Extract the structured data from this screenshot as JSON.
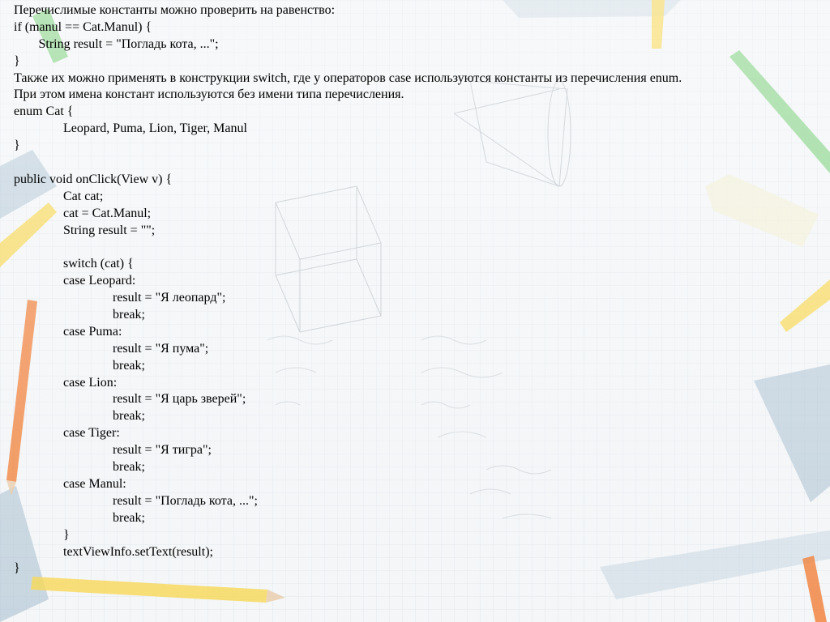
{
  "lines": [
    {
      "indent": 0,
      "text": "Перечислимые константы можно проверить на равенство:"
    },
    {
      "indent": 0,
      "text": "if (manul == Cat.Manul) {"
    },
    {
      "indent": 0.5,
      "text": "String result = \"Погладь кота, ...\";"
    },
    {
      "indent": 0,
      "text": "}"
    },
    {
      "indent": 0,
      "text": "Также их можно применять в конструкции switch, где у операторов case используются константы из перечисления enum."
    },
    {
      "indent": 0,
      "text": "При этом имена констант используются без имени типа перечисления."
    },
    {
      "indent": 0,
      "text": "enum Cat {"
    },
    {
      "indent": 1,
      "text": "Leopard, Puma, Lion, Tiger, Manul"
    },
    {
      "indent": 0,
      "text": "}"
    },
    {
      "indent": 0,
      "text": ""
    },
    {
      "indent": 0,
      "text": "public void onClick(View v) {"
    },
    {
      "indent": 1,
      "text": "Cat cat;"
    },
    {
      "indent": 1,
      "text": "cat = Cat.Manul;"
    },
    {
      "indent": 1,
      "text": "String result = \"\";"
    },
    {
      "indent": 0,
      "text": ""
    },
    {
      "indent": 1,
      "text": "switch (cat) {"
    },
    {
      "indent": 1,
      "text": "case Leopard:"
    },
    {
      "indent": 2,
      "text": "result = \"Я леопард\";"
    },
    {
      "indent": 2,
      "text": "break;"
    },
    {
      "indent": 1,
      "text": "case Puma:"
    },
    {
      "indent": 2,
      "text": "result = \"Я пума\";"
    },
    {
      "indent": 2,
      "text": "break;"
    },
    {
      "indent": 1,
      "text": "case Lion:"
    },
    {
      "indent": 2,
      "text": "result = \"Я царь зверей\";"
    },
    {
      "indent": 2,
      "text": "break;"
    },
    {
      "indent": 1,
      "text": "case Tiger:"
    },
    {
      "indent": 2,
      "text": "result = \"Я тигра\";"
    },
    {
      "indent": 2,
      "text": "break;"
    },
    {
      "indent": 1,
      "text": "case Manul:"
    },
    {
      "indent": 2,
      "text": "result = \"Погладь кота, ...\";"
    },
    {
      "indent": 2,
      "text": "break;"
    },
    {
      "indent": 1,
      "text": "}"
    },
    {
      "indent": 1,
      "text": "textViewInfo.setText(result);"
    },
    {
      "indent": 0,
      "text": "}"
    }
  ],
  "colors": {
    "text": "#000000",
    "background": "#f3f5f7",
    "grid": "#dde3ea",
    "pencil_orange": "#f0772a",
    "pencil_yellow": "#f7d64b",
    "pencil_green": "#7ccf7c",
    "ruler_blue": "#9fb8cc"
  },
  "decor": {
    "background_theme": "graph-paper-with-school-supplies",
    "icons": [
      "pencil-icon",
      "ruler-icon",
      "eraser-icon",
      "geometry-sketch-icon"
    ]
  }
}
